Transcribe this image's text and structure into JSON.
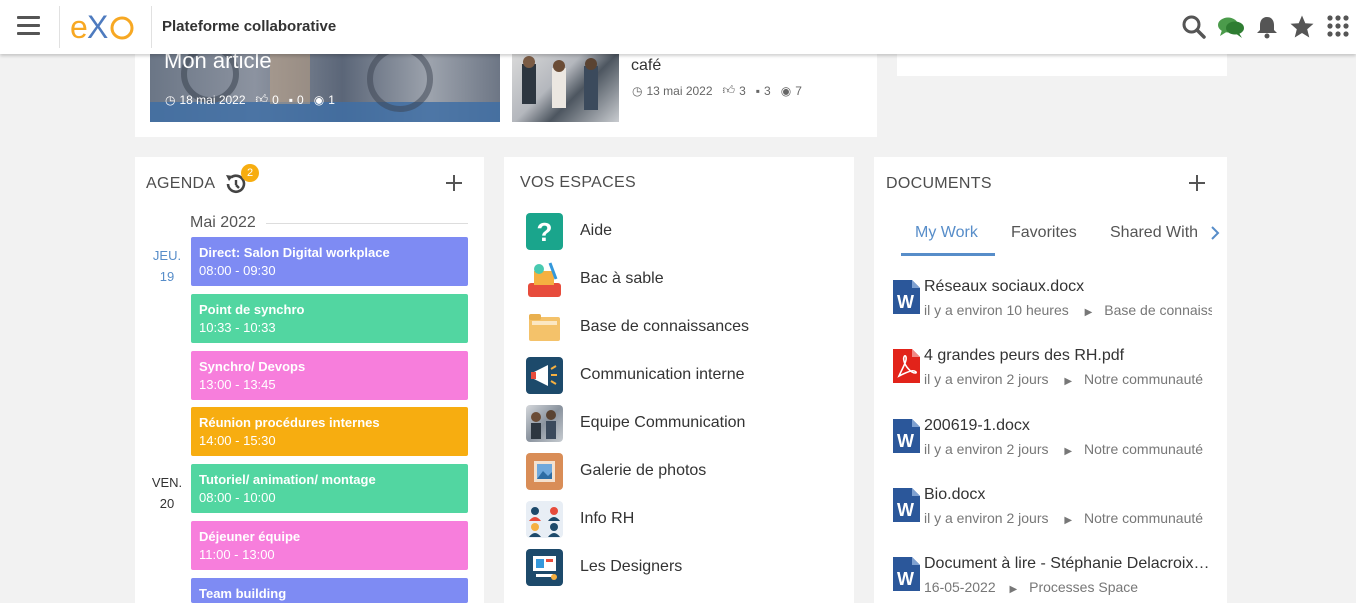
{
  "header": {
    "logo_text": "eXo",
    "title": "Plateforme collaborative"
  },
  "news": {
    "item1": {
      "title": "Mon article",
      "date": "18 mai 2022",
      "likes": "0",
      "comments": "0",
      "views": "1"
    },
    "item2": {
      "title": "café",
      "date": "13 mai 2022",
      "likes": "3",
      "comments": "3",
      "views": "7"
    }
  },
  "agenda": {
    "title": "AGENDA",
    "badge": "2",
    "month": "Mai 2022",
    "days": [
      {
        "name": "JEU.",
        "num": "19"
      },
      {
        "name": "VEN.",
        "num": "20"
      }
    ],
    "events": [
      {
        "title": "Direct: Salon Digital workplace",
        "time": "08:00  -  09:30",
        "color": "#7e8bf3"
      },
      {
        "title": "Point de synchro",
        "time": "10:33  -  10:33",
        "color": "#52d6a1"
      },
      {
        "title": "Synchro/ Devops",
        "time": "13:00  -  13:45",
        "color": "#f77edc"
      },
      {
        "title": "Réunion procédures internes",
        "time": "14:00  -  15:30",
        "color": "#f7ad10"
      },
      {
        "title": "Tutoriel/ animation/ montage",
        "time": "08:00  -  10:00",
        "color": "#52d6a1"
      },
      {
        "title": "Déjeuner équipe",
        "time": "11:00  -  13:00",
        "color": "#f77edc"
      },
      {
        "title": "Team building",
        "time": "",
        "color": "#7e8bf3"
      }
    ]
  },
  "spaces": {
    "title": "VOS ESPACES",
    "items": [
      {
        "name": "Aide",
        "icon": "help-icon"
      },
      {
        "name": "Bac à sable",
        "icon": "sandbox-icon"
      },
      {
        "name": "Base de connaissances",
        "icon": "folder-icon"
      },
      {
        "name": "Communication interne",
        "icon": "megaphone-icon"
      },
      {
        "name": "Equipe Communication",
        "icon": "team-photo-icon"
      },
      {
        "name": "Galerie de photos",
        "icon": "photo-gallery-icon"
      },
      {
        "name": "Info RH",
        "icon": "hr-people-icon"
      },
      {
        "name": "Les Designers",
        "icon": "designers-icon"
      }
    ]
  },
  "documents": {
    "title": "DOCUMENTS",
    "tabs": [
      "My Work",
      "Favorites",
      "Shared With"
    ],
    "items": [
      {
        "name": "Réseaux sociaux.docx",
        "time": "il y a environ 10 heures",
        "location": "Base de connaissances",
        "type": "word"
      },
      {
        "name": "4 grandes peurs des RH.pdf",
        "time": "il y a environ 2 jours",
        "location": "Notre communauté",
        "type": "pdf"
      },
      {
        "name": "200619-1.docx",
        "time": "il y a environ 2 jours",
        "location": "Notre communauté",
        "type": "word"
      },
      {
        "name": "Bio.docx",
        "time": "il y a environ 2 jours",
        "location": "Notre communauté",
        "type": "word"
      },
      {
        "name": "Document à lire - Stéphanie Delacroix.docx",
        "time": "16-05-2022",
        "location": "Processes Space",
        "type": "word"
      }
    ]
  }
}
